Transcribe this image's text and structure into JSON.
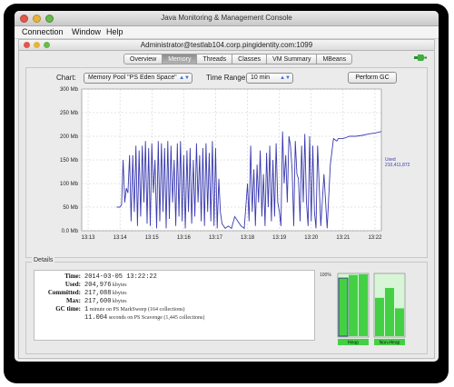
{
  "app": {
    "title": "Java Monitoring & Management Console"
  },
  "menu": [
    "Connection",
    "Window",
    "Help"
  ],
  "connection": {
    "title": "Administrator@testlab104.corp.pingidentity.com:1099"
  },
  "tabs": [
    {
      "label": "Overview",
      "active": false
    },
    {
      "label": "Memory",
      "active": true
    },
    {
      "label": "Threads",
      "active": false
    },
    {
      "label": "Classes",
      "active": false
    },
    {
      "label": "VM Summary",
      "active": false
    },
    {
      "label": "MBeans",
      "active": false
    }
  ],
  "controls": {
    "chart_label": "Chart:",
    "chart_value": "Memory Pool \"PS Eden Space\"",
    "range_label": "Time Range:",
    "range_value": "10 min",
    "gc_button": "Perform GC"
  },
  "chart_data": {
    "type": "line",
    "ylim": [
      0,
      300
    ],
    "y_ticks": [
      "300 Mb",
      "250 Mb",
      "200 Mb",
      "150 Mb",
      "100 Mb",
      "50 Mb",
      "0.0 Mb"
    ],
    "x_ticks": [
      "13:13",
      "13:14",
      "13:15",
      "13:16",
      "13:17",
      "13:18",
      "13:19",
      "13:20",
      "13:21",
      "13:22"
    ],
    "series": [
      {
        "name": "Used",
        "color": "#3a3ab0",
        "x_minutes": [
          13.9,
          14.0,
          14.05,
          14.1,
          14.15,
          14.2,
          14.25,
          14.3,
          14.35,
          14.4,
          14.45,
          14.5,
          14.55,
          14.6,
          14.65,
          14.7,
          14.75,
          14.8,
          14.85,
          14.9,
          14.95,
          15.0,
          15.05,
          15.1,
          15.15,
          15.2,
          15.25,
          15.3,
          15.35,
          15.4,
          15.45,
          15.5,
          15.55,
          15.6,
          15.65,
          15.7,
          15.75,
          15.8,
          15.85,
          15.9,
          15.95,
          16.0,
          16.05,
          16.1,
          16.15,
          16.2,
          16.25,
          16.3,
          16.35,
          16.4,
          16.45,
          16.5,
          16.55,
          16.6,
          16.65,
          16.7,
          16.75,
          16.8,
          16.85,
          16.9,
          16.95,
          17.0,
          17.05,
          17.1,
          17.15,
          17.2,
          17.3,
          17.4,
          17.5,
          17.6,
          17.7,
          17.8,
          17.9,
          18.0,
          18.05,
          18.1,
          18.15,
          18.2,
          18.25,
          18.3,
          18.35,
          18.4,
          18.45,
          18.5,
          18.55,
          18.6,
          18.65,
          18.7,
          18.75,
          18.8,
          18.85,
          18.9,
          18.95,
          19.0,
          19.05,
          19.1,
          19.15,
          19.2,
          19.25,
          19.3,
          19.35,
          19.4,
          19.45,
          19.5,
          19.55,
          19.6,
          19.65,
          19.7,
          19.75,
          19.8,
          19.85,
          19.9,
          19.95,
          20.0,
          20.05,
          20.1,
          20.15,
          20.2,
          20.3,
          20.4,
          20.5,
          20.6,
          20.7,
          20.8,
          20.85,
          20.9,
          21.0,
          21.2,
          21.4,
          21.6,
          21.8,
          22.0,
          22.2
        ],
        "values": [
          50,
          50,
          55,
          150,
          60,
          90,
          80,
          160,
          20,
          160,
          40,
          180,
          10,
          170,
          30,
          180,
          60,
          190,
          15,
          175,
          10,
          185,
          80,
          150,
          5,
          190,
          20,
          185,
          40,
          175,
          5,
          190,
          25,
          180,
          60,
          150,
          10,
          185,
          30,
          190,
          20,
          160,
          5,
          170,
          40,
          175,
          15,
          150,
          30,
          185,
          60,
          160,
          20,
          175,
          10,
          185,
          40,
          165,
          20,
          190,
          10,
          175,
          5,
          110,
          40,
          15,
          5,
          10,
          5,
          30,
          20,
          10,
          5,
          100,
          20,
          180,
          40,
          130,
          10,
          140,
          60,
          170,
          30,
          120,
          10,
          165,
          50,
          180,
          20,
          150,
          30,
          185,
          60,
          40,
          10,
          210,
          100,
          160,
          60,
          200,
          180,
          130,
          10,
          190,
          120,
          110,
          20,
          180,
          60,
          205,
          60,
          10,
          200,
          20,
          180,
          40,
          5,
          180,
          10,
          120,
          5,
          140,
          195,
          190,
          195,
          195,
          195,
          200,
          200,
          202,
          205,
          207,
          210,
          212
        ]
      }
    ],
    "annotation": {
      "label": "Used",
      "value": "210,411,872"
    }
  },
  "details": {
    "legend": "Details",
    "rows": [
      {
        "label": "Time:",
        "value": "2014-03-05 13:22:22",
        "unit": ""
      },
      {
        "label": "Used:",
        "value": "204,976",
        "unit": "kbytes"
      },
      {
        "label": "Committed:",
        "value": "217,088",
        "unit": "kbytes"
      },
      {
        "label": "Max:",
        "value": "217,600",
        "unit": "kbytes"
      },
      {
        "label": "GC time:",
        "value": "1",
        "unit": "minute on PS MarkSweep (164 collections)"
      },
      {
        "label": "",
        "value": "11.004",
        "unit": "seconds on PS Scavenge (1,445 collections)"
      }
    ]
  },
  "heap_bars": {
    "percent_label": "100%",
    "color": "#44d044",
    "groups": [
      {
        "label": "Heap",
        "bars": [
          0.94,
          0.99,
          1.0
        ]
      },
      {
        "label": "Non-Heap",
        "bars": [
          0.62,
          0.78,
          0.45
        ]
      }
    ]
  }
}
